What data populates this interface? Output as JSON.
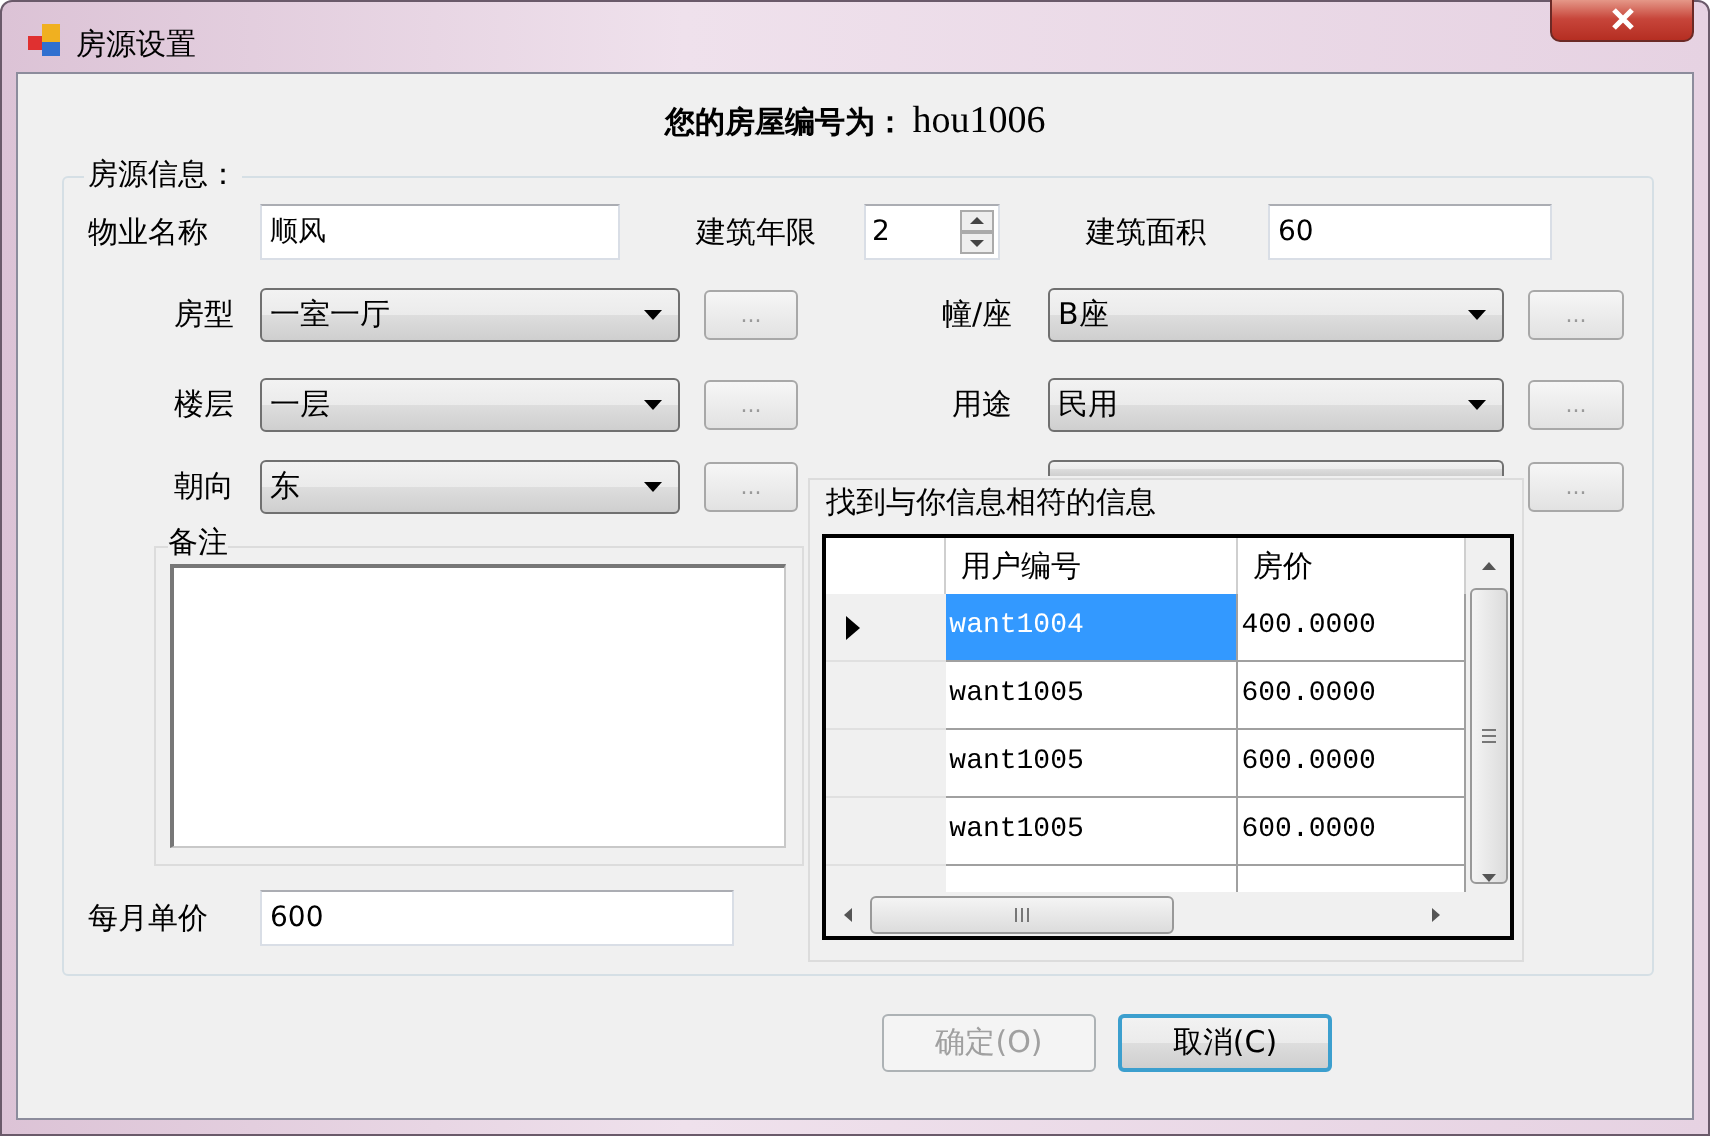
{
  "window": {
    "title": "房源设置"
  },
  "header": {
    "label": "您的房屋编号为：",
    "value": "hou1006"
  },
  "group": {
    "title": "房源信息："
  },
  "top_fields": [
    {
      "kind": "text",
      "label": "物业名称",
      "value": "顺风"
    },
    {
      "kind": "spin",
      "label": "建筑年限",
      "value": "2"
    },
    {
      "kind": "text",
      "label": "建筑面积",
      "value": "60"
    }
  ],
  "left_combos": [
    {
      "label": "房型",
      "value": "一室一厅",
      "button": "..."
    },
    {
      "label": "楼层",
      "value": "一层",
      "button": "..."
    },
    {
      "label": "朝向",
      "value": "东",
      "button": "..."
    }
  ],
  "right_combos": [
    {
      "label": "幢/座",
      "value": "B座",
      "button": "..."
    },
    {
      "label": "用途",
      "value": "民用",
      "button": "..."
    },
    {
      "button": "..."
    }
  ],
  "remarks": {
    "title": "备注"
  },
  "monthly_price": {
    "label": "每月单价",
    "value": "600"
  },
  "matches": {
    "title": "找到与你信息相符的信息",
    "columns": [
      "用户编号",
      "房价"
    ],
    "rows": [
      {
        "cells": [
          "want1004",
          "400.0000"
        ],
        "selected": true,
        "current": true
      },
      {
        "cells": [
          "want1005",
          "600.0000"
        ],
        "selected": false,
        "current": false
      },
      {
        "cells": [
          "want1005",
          "600.0000"
        ],
        "selected": false,
        "current": false
      },
      {
        "cells": [
          "want1005",
          "600.0000"
        ],
        "selected": false,
        "current": false
      }
    ]
  },
  "buttons": [
    {
      "label": "确定(O)",
      "disabled": true,
      "default": false
    },
    {
      "label": "取消(C)",
      "disabled": false,
      "default": true
    }
  ]
}
